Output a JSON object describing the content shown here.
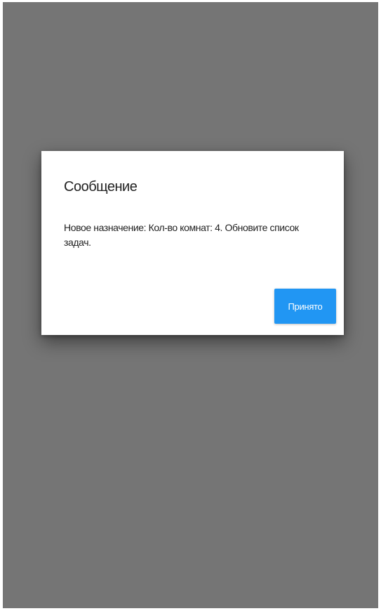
{
  "dialog": {
    "title": "Сообщение",
    "message": "Новое назначение: Кол-во комнат: 4. Обновите список задач.",
    "accept_label": "Принято"
  },
  "colors": {
    "backdrop": "#757575",
    "dialog_background": "#ffffff",
    "accent": "#2196f3"
  }
}
